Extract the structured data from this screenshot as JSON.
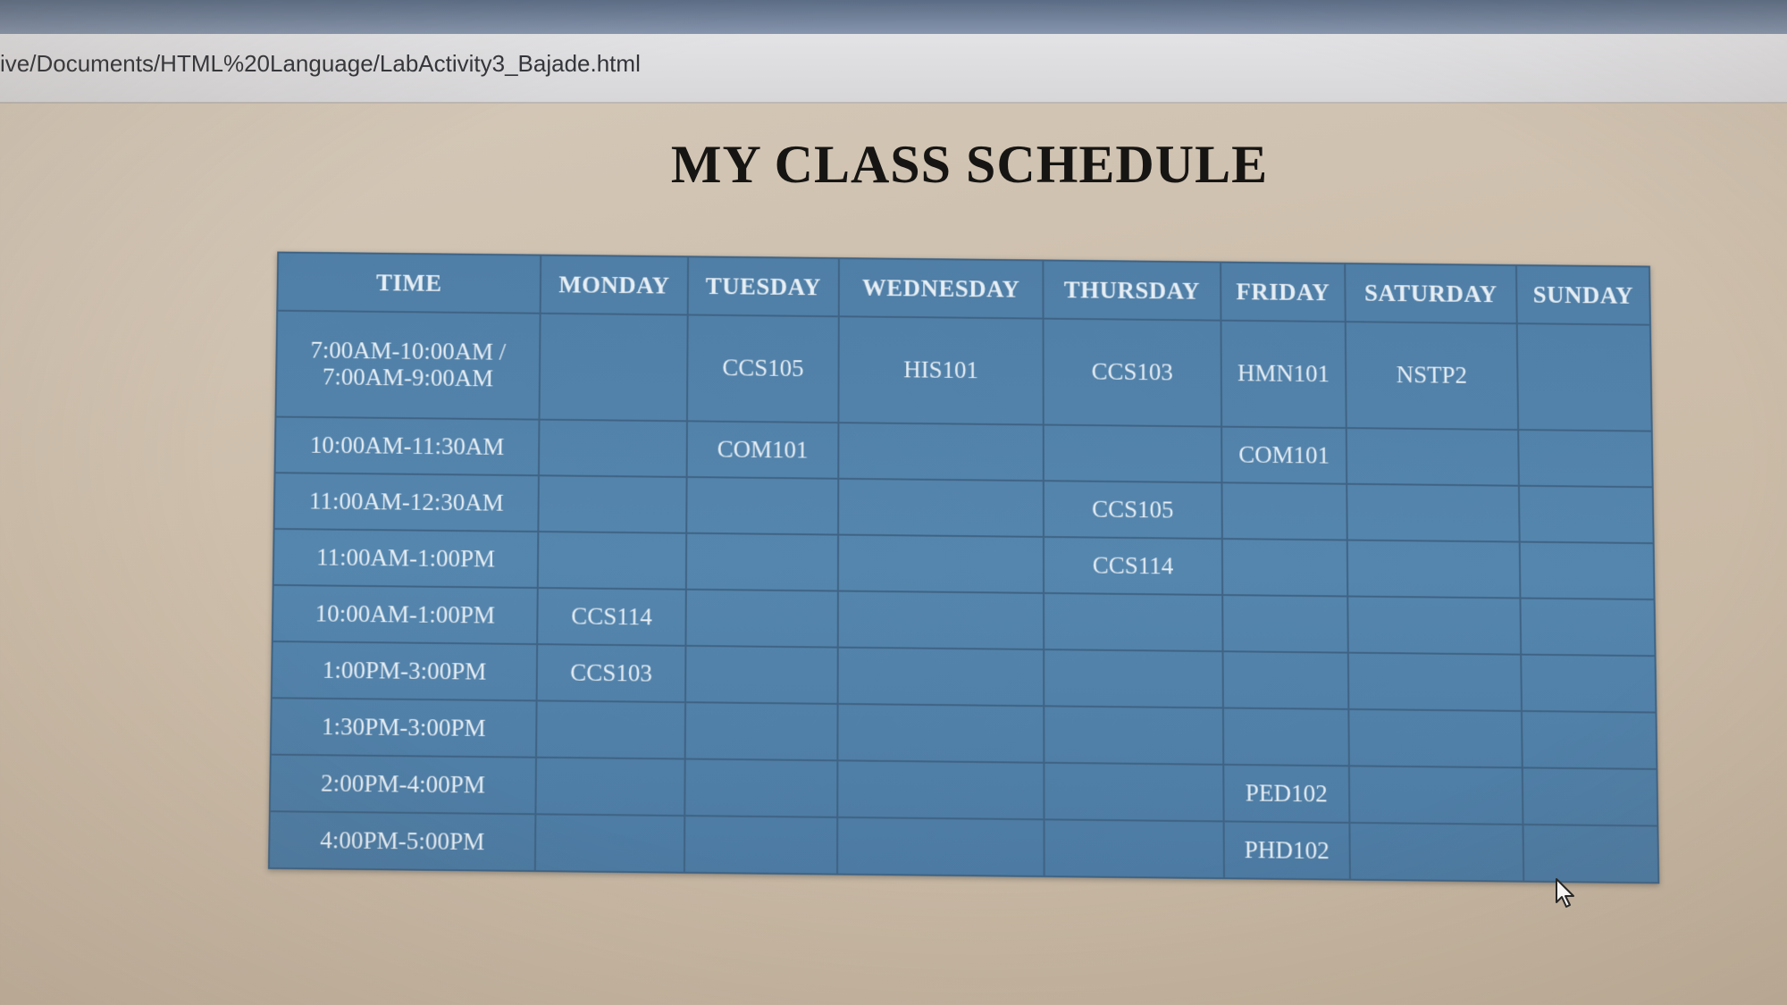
{
  "browser": {
    "address_url": "ive/Documents/HTML%20Language/LabActivity3_Bajade.html"
  },
  "page": {
    "title": "MY CLASS SCHEDULE"
  },
  "schedule": {
    "headers": [
      "TIME",
      "MONDAY",
      "TUESDAY",
      "WEDNESDAY",
      "THURSDAY",
      "FRIDAY",
      "SATURDAY",
      "SUNDAY"
    ],
    "rows": [
      [
        "7:00AM-10:00AM /\n7:00AM-9:00AM",
        "",
        "CCS105",
        "HIS101",
        "CCS103",
        "HMN101",
        "NSTP2",
        ""
      ],
      [
        "10:00AM-11:30AM",
        "",
        "COM101",
        "",
        "",
        "COM101",
        "",
        ""
      ],
      [
        "11:00AM-12:30AM",
        "",
        "",
        "",
        "CCS105",
        "",
        "",
        ""
      ],
      [
        "11:00AM-1:00PM",
        "",
        "",
        "",
        "CCS114",
        "",
        "",
        ""
      ],
      [
        "10:00AM-1:00PM",
        "CCS114",
        "",
        "",
        "",
        "",
        "",
        ""
      ],
      [
        "1:00PM-3:00PM",
        "CCS103",
        "",
        "",
        "",
        "",
        "",
        ""
      ],
      [
        "1:30PM-3:00PM",
        "",
        "",
        "",
        "",
        "",
        "",
        ""
      ],
      [
        "2:00PM-4:00PM",
        "",
        "",
        "",
        "",
        "PED102",
        "",
        ""
      ],
      [
        "4:00PM-5:00PM",
        "",
        "",
        "",
        "",
        "PHD102",
        "",
        ""
      ]
    ]
  },
  "colors": {
    "table_background": "#5586ae",
    "table_border": "#3f6384",
    "table_text": "#e6eef4",
    "page_background": "#cdbeab",
    "title_text": "#161513"
  },
  "icons": {
    "cursor": "mouse-pointer-icon"
  }
}
